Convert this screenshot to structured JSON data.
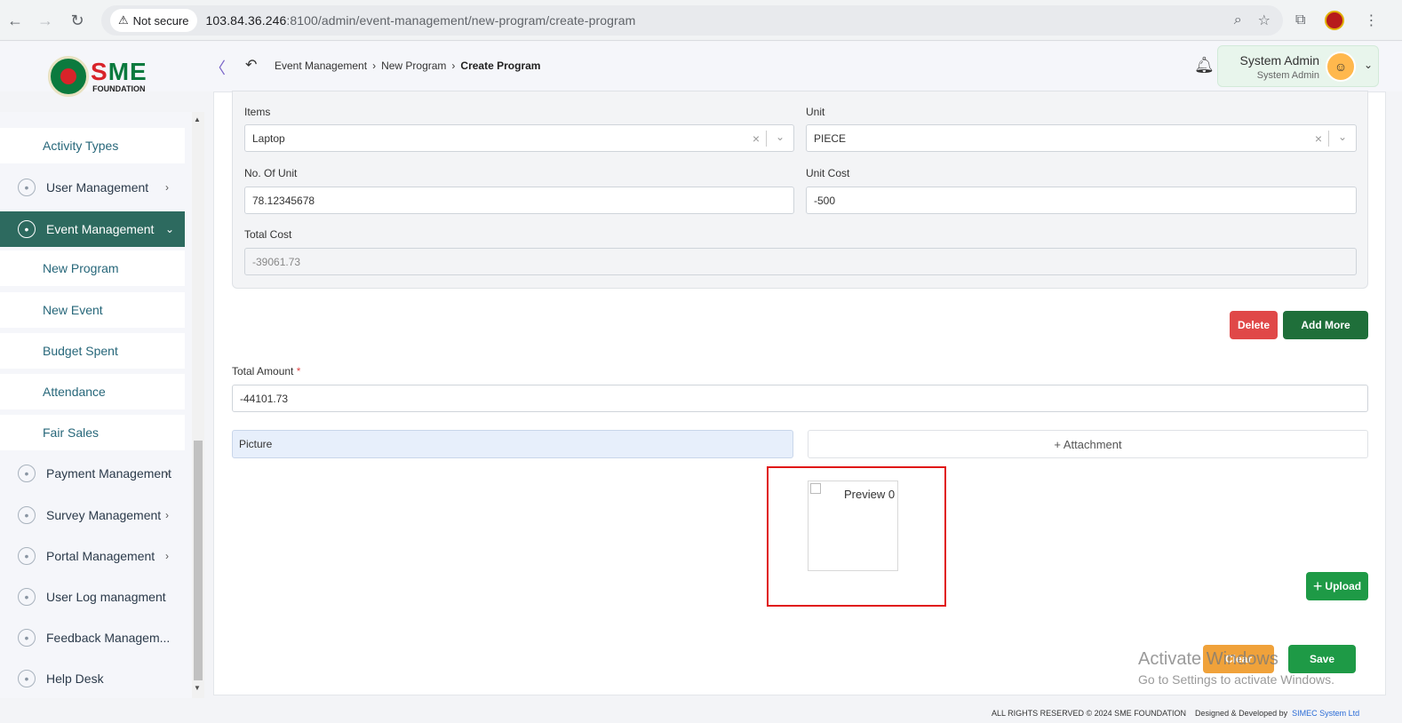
{
  "browser": {
    "secure_label": "Not secure",
    "url_host": "103.84.36.246",
    "url_rest": ":8100/admin/event-management/new-program/create-program"
  },
  "header": {
    "logo_text_s": "S",
    "logo_text_me": "ME",
    "logo_foundation": "FOUNDATION",
    "breadcrumb": [
      "Event Management",
      "New Program",
      "Create Program"
    ],
    "user_name": "System Admin",
    "user_role": "System Admin"
  },
  "sidebar": {
    "items": [
      {
        "label": "Activity Types",
        "type": "sub"
      },
      {
        "label": "User Management",
        "type": "main",
        "icon": "shield-icon"
      },
      {
        "label": "Event Management",
        "type": "main",
        "icon": "lock-icon",
        "active": true
      },
      {
        "label": "New Program",
        "type": "sub"
      },
      {
        "label": "New Event",
        "type": "sub"
      },
      {
        "label": "Budget Spent",
        "type": "sub"
      },
      {
        "label": "Attendance",
        "type": "sub"
      },
      {
        "label": "Fair Sales",
        "type": "sub"
      },
      {
        "label": "Payment Management",
        "type": "main",
        "icon": "card-icon"
      },
      {
        "label": "Survey Management",
        "type": "main",
        "icon": "pie-chart-icon"
      },
      {
        "label": "Portal Management",
        "type": "main",
        "icon": "lock-icon"
      },
      {
        "label": "User Log managment",
        "type": "main",
        "icon": "log-icon"
      },
      {
        "label": "Feedback Managem...",
        "type": "main",
        "icon": "feedback-icon"
      },
      {
        "label": "Help Desk",
        "type": "main",
        "icon": "mail-icon"
      }
    ]
  },
  "form": {
    "items_label": "Items",
    "items_value": "Laptop",
    "unit_label": "Unit",
    "unit_value": "PIECE",
    "no_of_unit_label": "No. Of Unit",
    "no_of_unit_value": "78.12345678",
    "unit_cost_label": "Unit Cost",
    "unit_cost_value": "-500",
    "total_cost_label": "Total Cost",
    "total_cost_value": "-39061.73",
    "delete_label": "Delete",
    "add_more_label": "Add More",
    "total_amount_label": "Total Amount",
    "total_amount_required": "*",
    "total_amount_value": "-44101.73",
    "picture_label": "Picture",
    "attachment_label": "+ Attachment",
    "preview_label": "Preview 0",
    "upload_label": "Upload",
    "clear_label": "Clear",
    "save_label": "Save"
  },
  "watermark": {
    "line1": "Activate Windows",
    "line2": "Go to Settings to activate Windows."
  },
  "footer": {
    "rights": "ALL RIGHTS RESERVED © 2024 SME FOUNDATION",
    "designed": "Designed & Developed by",
    "company": "SIMEC System Ltd"
  },
  "colors": {
    "primary_green": "#1e9a46",
    "sidebar_active": "#2d6a5f",
    "danger": "#e04848",
    "clear_orange": "#f0a23a",
    "highlight_red": "#e01414"
  }
}
